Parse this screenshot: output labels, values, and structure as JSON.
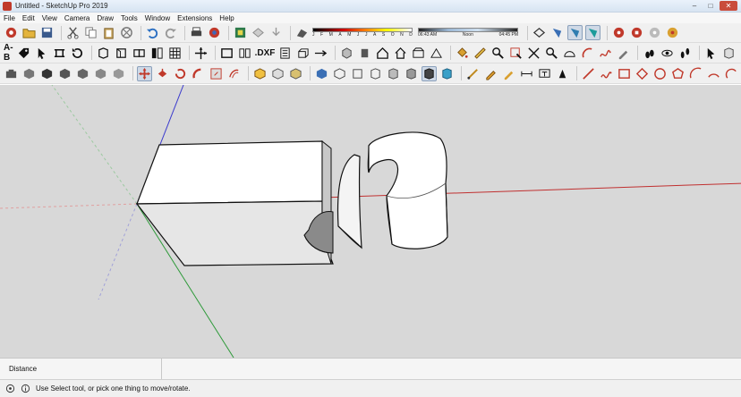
{
  "window": {
    "title": "Untitled - SketchUp Pro 2019",
    "minimize": "–",
    "maximize": "□",
    "close": "✕"
  },
  "menu": [
    "File",
    "Edit",
    "View",
    "Camera",
    "Draw",
    "Tools",
    "Window",
    "Extensions",
    "Help"
  ],
  "toolbar": {
    "shadow_months": [
      "J",
      "F",
      "M",
      "A",
      "M",
      "J",
      "J",
      "A",
      "S",
      "O",
      "N",
      "D"
    ],
    "time_start": "06:43 AM",
    "time_noon": "Noon",
    "time_end": "04:45 PM",
    "label_ab": "A-B",
    "label_dxf": ".DXF"
  },
  "measurements": {
    "label": "Distance"
  },
  "status": {
    "text": "Use Select tool, or pick one thing to move/rotate."
  },
  "colors": {
    "viewport_bg": "#d8d8d8",
    "red_axis": "#c03030",
    "green_axis": "#2e9a3a",
    "blue_axis": "#3a3acd"
  }
}
